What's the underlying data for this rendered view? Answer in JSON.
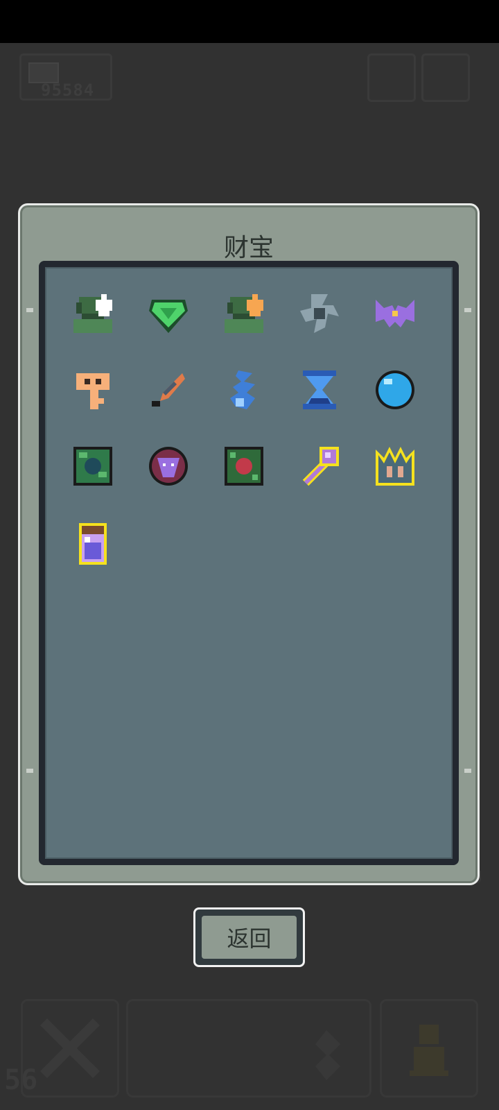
{
  "hud": {
    "gold_value": "95584",
    "level_value": "56"
  },
  "panel": {
    "title": "财宝"
  },
  "treasures": [
    {
      "icon": "green-helmet-white-arrow-icon"
    },
    {
      "icon": "green-gem-shield-icon"
    },
    {
      "icon": "green-helmet-orange-arrow-icon"
    },
    {
      "icon": "steel-shuriken-icon"
    },
    {
      "icon": "purple-bat-wings-icon"
    },
    {
      "icon": "orange-key-icon"
    },
    {
      "icon": "feather-quill-icon"
    },
    {
      "icon": "blue-spirit-flame-icon"
    },
    {
      "icon": "blue-hourglass-icon"
    },
    {
      "icon": "blue-orb-icon"
    },
    {
      "icon": "green-vine-tile-icon"
    },
    {
      "icon": "demon-face-medallion-icon"
    },
    {
      "icon": "red-rose-tile-icon"
    },
    {
      "icon": "purple-staff-icon"
    },
    {
      "icon": "spiked-crown-icon"
    },
    {
      "icon": "potion-jar-icon"
    }
  ],
  "footer": {
    "back_label": "返回"
  },
  "colors": {
    "panel": "#8f9b91",
    "inner": "#5d727a",
    "rare_outline": "#f5e11e"
  }
}
